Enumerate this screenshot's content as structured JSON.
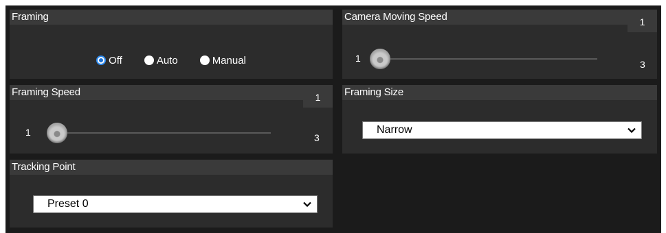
{
  "framing": {
    "title": "Framing",
    "options": [
      {
        "label": "Off",
        "selected": true
      },
      {
        "label": "Auto",
        "selected": false
      },
      {
        "label": "Manual",
        "selected": false
      }
    ]
  },
  "camera_moving_speed": {
    "title": "Camera Moving Speed",
    "value": "1",
    "min": "1",
    "max": "3"
  },
  "framing_speed": {
    "title": "Framing Speed",
    "value": "1",
    "min": "1",
    "max": "3"
  },
  "framing_size": {
    "title": "Framing Size",
    "selected": "Narrow"
  },
  "tracking_point": {
    "title": "Tracking Point",
    "selected": "Preset 0"
  },
  "colors": {
    "background": "#1b1b1b",
    "panel": "#2c2c2c",
    "header": "#3a3a3a",
    "radio_selected": "#2f8cf0"
  },
  "icons": {
    "select_arrow": "chevron-down-icon"
  }
}
